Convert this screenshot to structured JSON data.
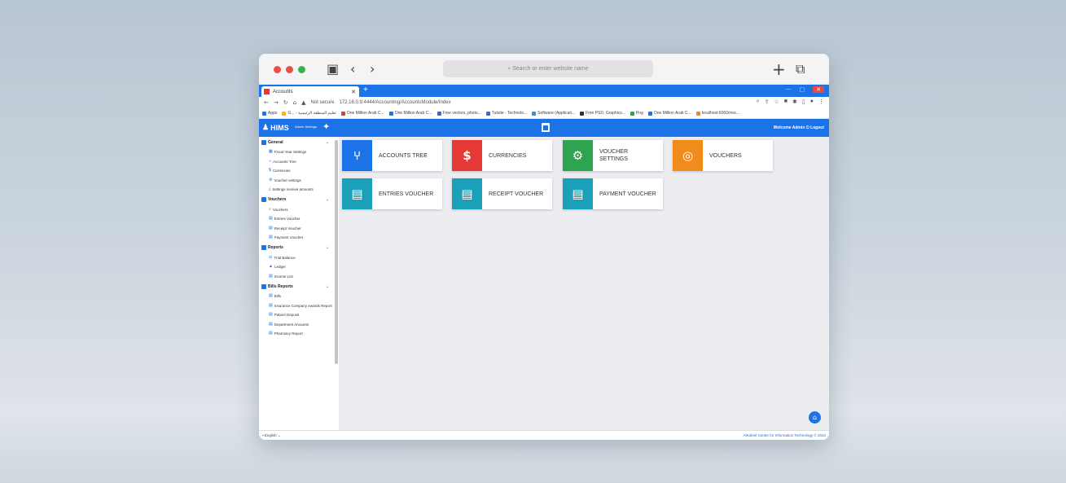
{
  "safari": {
    "search_placeholder": "Search or enter website name"
  },
  "browser": {
    "tab_title": "Accounts",
    "url_prefix": "Not secure",
    "url": "172.16.0.9:4444/Accounting/AccountsModule/Index",
    "bookmarks": [
      "Apps",
      "G... - تعليم المنطقة الرئيسية",
      "One Million Arab C...",
      "One Million Arab C...",
      "Free vectors, photo...",
      "Tutsite - Technolo...",
      "Software (Applicati...",
      "Free PSD, Graphics...",
      "Png",
      "One Million Arab C...",
      "localhost:6060/mvc..."
    ]
  },
  "app": {
    "logo": "HIMS",
    "admin_settings": "Admin Settings",
    "welcome": "Welcome Admin",
    "logout": "Logout"
  },
  "sidebar": {
    "sections": [
      {
        "title": "General",
        "items": [
          "Fiscal Year Settings",
          "Accounts Tree",
          "Currencies",
          "Voucher settings",
          "Settings receive amounts"
        ]
      },
      {
        "title": "Vouchers",
        "items": [
          "Vouchers",
          "Entries Voucher",
          "Receipt Voucher",
          "Payment Voucher"
        ]
      },
      {
        "title": "Reports",
        "items": [
          "Trial Balance",
          "Ledger",
          "Income List"
        ]
      },
      {
        "title": "Bills Reports",
        "items": [
          "Bills",
          "Insurance Company Awards Report",
          "Patient Deposit",
          "Department Amounts",
          "Pharmacy Report"
        ]
      }
    ]
  },
  "tiles": [
    {
      "label": "ACCOUNTS TREE",
      "icon": "branch-icon",
      "color": "#1c73e7"
    },
    {
      "label": "CURRENCIES",
      "icon": "dollar-icon",
      "color": "#e53935"
    },
    {
      "label": "VOUCHER SETTINGS",
      "icon": "gears-icon",
      "color": "#2ea44f"
    },
    {
      "label": "VOUCHERS",
      "icon": "search-dollar-icon",
      "color": "#f08c1c"
    },
    {
      "label": "ENTRIES VOUCHER",
      "icon": "doc-icon",
      "color": "#1aa0b8"
    },
    {
      "label": "RECEIPT VOUCHER",
      "icon": "receipt-icon",
      "color": "#1aa0b8"
    },
    {
      "label": "PAYMENT VOUCHER",
      "icon": "invoice-icon",
      "color": "#1aa0b8"
    }
  ],
  "footer": {
    "language": "English",
    "copyright": "AlKafeel Center for Information Technology © 2022"
  }
}
